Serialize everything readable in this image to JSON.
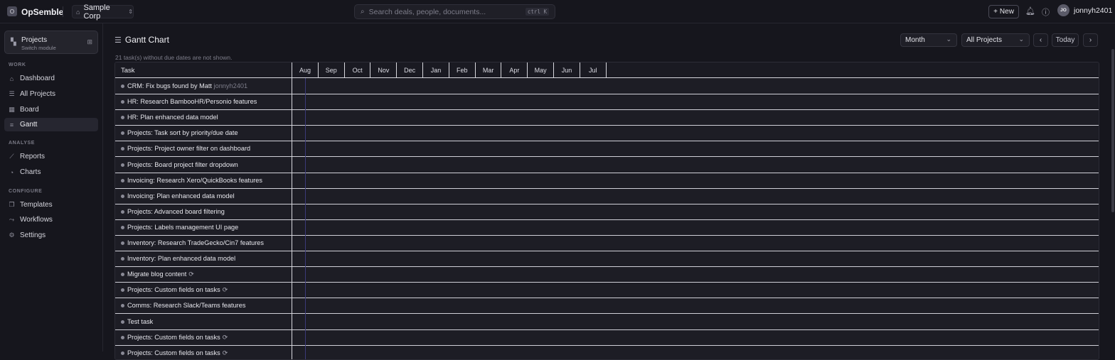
{
  "app": {
    "logo_letter": "O",
    "name": "OpSemble"
  },
  "org": {
    "name": "Sample Corp"
  },
  "search": {
    "placeholder": "Search deals, people, documents...",
    "shortcut": "ctrl K"
  },
  "header_actions": {
    "new_label": "New",
    "user_initials": "JO",
    "user_name": "jonnyh2401"
  },
  "module": {
    "title": "Projects",
    "subtitle": "Switch module"
  },
  "sidebar": {
    "sections": [
      {
        "label": "WORK",
        "items": [
          {
            "label": "Dashboard",
            "icon": "dashboard-icon"
          },
          {
            "label": "All Projects",
            "icon": "list-icon"
          },
          {
            "label": "Board",
            "icon": "board-icon"
          },
          {
            "label": "Gantt",
            "icon": "gantt-icon",
            "active": true
          }
        ]
      },
      {
        "label": "ANALYSE",
        "items": [
          {
            "label": "Reports",
            "icon": "reports-icon"
          },
          {
            "label": "Charts",
            "icon": "charts-icon"
          }
        ]
      },
      {
        "label": "CONFIGURE",
        "items": [
          {
            "label": "Templates",
            "icon": "templates-icon"
          },
          {
            "label": "Workflows",
            "icon": "workflows-icon"
          },
          {
            "label": "Settings",
            "icon": "settings-icon"
          }
        ]
      }
    ]
  },
  "page": {
    "title": "Gantt Chart",
    "notice": "21 task(s) without due dates are not shown.",
    "view_select": "Month",
    "project_select": "All Projects",
    "today_label": "Today"
  },
  "gantt": {
    "task_header": "Task",
    "months": [
      "Aug",
      "Sep",
      "Oct",
      "Nov",
      "Dec",
      "Jan",
      "Feb",
      "Mar",
      "Apr",
      "May",
      "Jun",
      "Jul"
    ],
    "tasks": [
      {
        "title": "CRM: Fix bugs found by Matt",
        "assignee": "jonnyh2401"
      },
      {
        "title": "HR: Research BambooHR/Personio features"
      },
      {
        "title": "HR: Plan enhanced data model"
      },
      {
        "title": "Projects: Task sort by priority/due date"
      },
      {
        "title": "Projects: Project owner filter on dashboard"
      },
      {
        "title": "Projects: Board project filter dropdown"
      },
      {
        "title": "Invoicing: Research Xero/QuickBooks features"
      },
      {
        "title": "Invoicing: Plan enhanced data model"
      },
      {
        "title": "Projects: Advanced board filtering"
      },
      {
        "title": "Projects: Labels management UI page"
      },
      {
        "title": "Inventory: Research TradeGecko/Cin7 features"
      },
      {
        "title": "Inventory: Plan enhanced data model"
      },
      {
        "title": "Migrate blog content",
        "recurring": true
      },
      {
        "title": "Projects: Custom fields on tasks",
        "recurring": true
      },
      {
        "title": "Comms: Research Slack/Teams features"
      },
      {
        "title": "Test task"
      },
      {
        "title": "Projects: Custom fields on tasks",
        "recurring": true
      },
      {
        "title": "Projects: Custom fields on tasks",
        "recurring": true
      }
    ]
  },
  "colors": {
    "background": "#16161d",
    "panel": "#1d1d25",
    "today_line": "#3b3a78",
    "grid_line": "#d8d8de"
  }
}
